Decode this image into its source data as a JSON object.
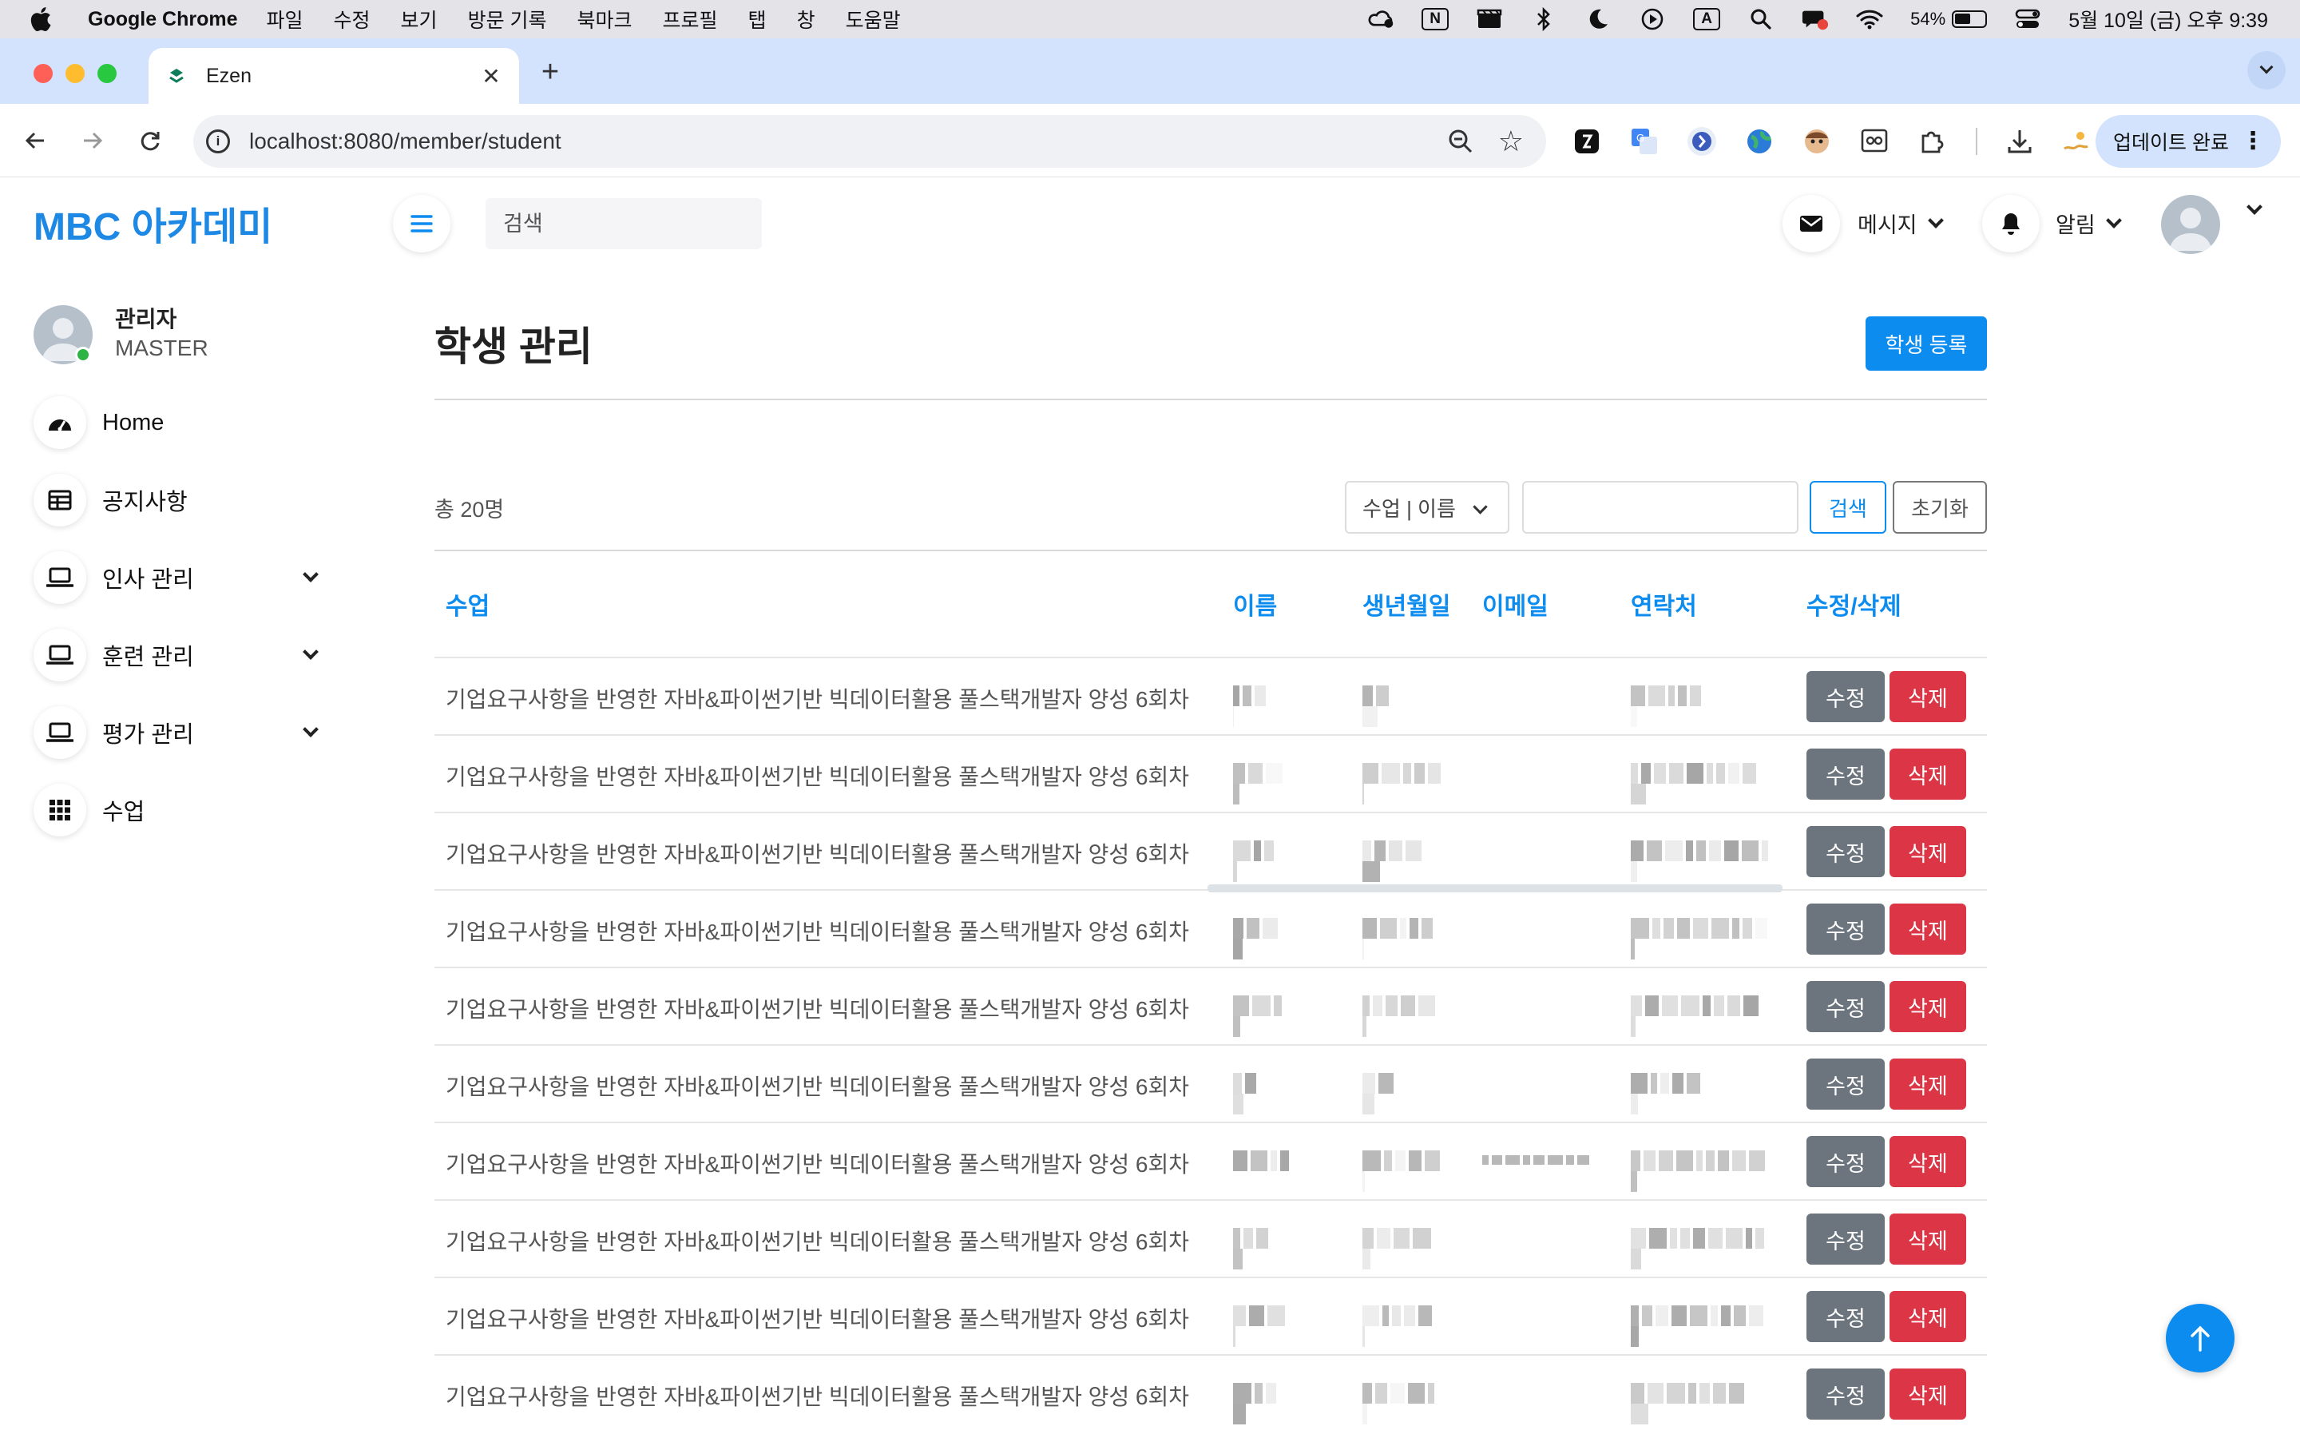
{
  "menubar": {
    "app_name": "Google Chrome",
    "items": [
      "파일",
      "수정",
      "보기",
      "방문 기록",
      "북마크",
      "프로필",
      "탭",
      "창",
      "도움말"
    ],
    "status_icons": [
      "creative-cloud-icon",
      "notion-icon",
      "clapper-icon",
      "bluetooth-icon",
      "moon-icon",
      "play-circle-icon",
      "input-source-icon",
      "spotlight-icon",
      "notification-icon",
      "wifi-icon"
    ],
    "input_source_label": "A",
    "notion_label": "N",
    "battery_percent": "54%",
    "battery_level": 0.54,
    "datetime": "5월 10일 (금) 오후 9:39"
  },
  "browser": {
    "tab_title": "Ezen",
    "tab_close": "✕",
    "new_tab": "+",
    "url": "localhost:8080/member/student",
    "update_label": "업데이트 완료",
    "update_menu": "⋮",
    "extension_icons": [
      "ext-black-icon",
      "google-translate-icon",
      "ext-blue-circle-icon",
      "ext-globe-icon",
      "ext-avatar-icon",
      "ext-reader-icon",
      "extensions-puzzle-icon",
      "download-icon",
      "ext-swimmer-icon"
    ]
  },
  "header": {
    "brand": "MBC 아카데미",
    "search_placeholder": "검색",
    "messages_label": "메시지",
    "alerts_label": "알림"
  },
  "sidebar": {
    "user_name": "관리자",
    "user_role": "MASTER",
    "items": [
      {
        "label": "Home",
        "icon": "dashboard-icon",
        "expandable": false
      },
      {
        "label": "공지사항",
        "icon": "table-icon",
        "expandable": false
      },
      {
        "label": "인사 관리",
        "icon": "laptop-icon",
        "expandable": true
      },
      {
        "label": "훈련 관리",
        "icon": "laptop-icon",
        "expandable": true
      },
      {
        "label": "평가 관리",
        "icon": "laptop-icon",
        "expandable": true
      },
      {
        "label": "수업",
        "icon": "grid-icon",
        "expandable": false
      }
    ]
  },
  "main": {
    "title": "학생 관리",
    "register_label": "학생 등록",
    "total_label": "총 20명",
    "filter_select_value": "수업 | 이름",
    "search_value": "",
    "search_label": "검색",
    "reset_label": "초기화",
    "columns": [
      "수업",
      "이름",
      "생년월일",
      "이메일",
      "연락처",
      "수정/삭제"
    ],
    "edit_label": "수정",
    "delete_label": "삭제",
    "rows": [
      {
        "course": "기업요구사항을 반영한 자바&파이썬기반 빅데이터활용 풀스택개발자 양성 6회차"
      },
      {
        "course": "기업요구사항을 반영한 자바&파이썬기반 빅데이터활용 풀스택개발자 양성 6회차"
      },
      {
        "course": "기업요구사항을 반영한 자바&파이썬기반 빅데이터활용 풀스택개발자 양성 6회차"
      },
      {
        "course": "기업요구사항을 반영한 자바&파이썬기반 빅데이터활용 풀스택개발자 양성 6회차"
      },
      {
        "course": "기업요구사항을 반영한 자바&파이썬기반 빅데이터활용 풀스택개발자 양성 6회차"
      },
      {
        "course": "기업요구사항을 반영한 자바&파이썬기반 빅데이터활용 풀스택개발자 양성 6회차"
      },
      {
        "course": "기업요구사항을 반영한 자바&파이썬기반 빅데이터활용 풀스택개발자 양성 6회차"
      },
      {
        "course": "기업요구사항을 반영한 자바&파이썬기반 빅데이터활용 풀스택개발자 양성 6회차"
      },
      {
        "course": "기업요구사항을 반영한 자바&파이썬기반 빅데이터활용 풀스택개발자 양성 6회차"
      },
      {
        "course": "기업요구사항을 반영한 자바&파이썬기반 빅데이터활용 풀스택개발자 양성 6회차"
      }
    ],
    "blurred_columns": [
      "이름",
      "생년월일",
      "이메일",
      "연락처"
    ]
  },
  "colors": {
    "accent": "#0d8cf0",
    "brand": "#1e88e5",
    "danger": "#dc3545",
    "secondary": "#6c757d",
    "tabstrip": "#d3e3fd"
  }
}
